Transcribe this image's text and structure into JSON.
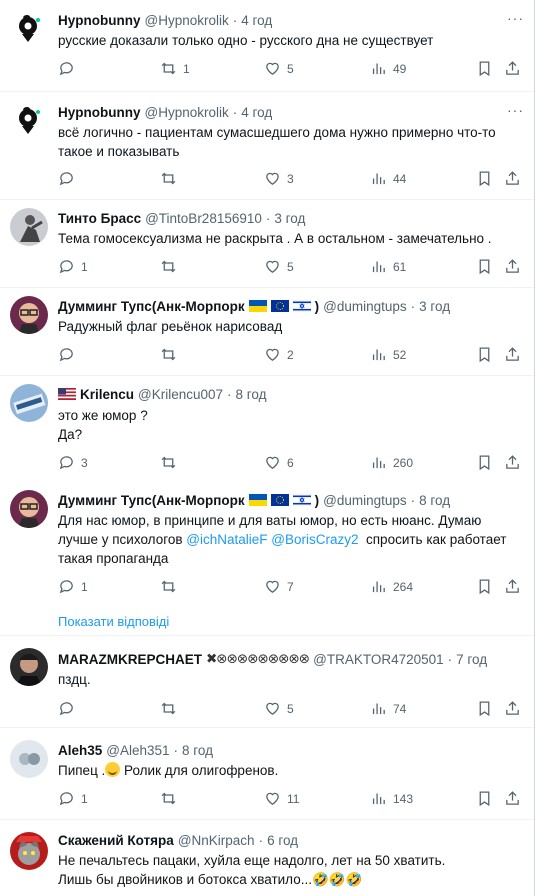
{
  "colors": {
    "accent": "#1d9bf0",
    "muted": "#536471",
    "border": "#eff3f4"
  },
  "tweets": [
    {
      "name": "Hypnobunny",
      "handle": "@Hypnokrolik",
      "time": "4 год",
      "text": "русские доказали только одно - русского дна не существует",
      "replies": "",
      "retweets": "1",
      "likes": "5",
      "views": "49"
    },
    {
      "name": "Hypnobunny",
      "handle": "@Hypnokrolik",
      "time": "4 год",
      "text": "всё логично - пациентам сумасшедшего дома нужно примерно что-то\nтакое и показывать",
      "replies": "",
      "retweets": "",
      "likes": "3",
      "views": "44"
    },
    {
      "name": "Тинто Брасс",
      "handle": "@TintoBr28156910",
      "time": "3 год",
      "text": "Тема гомосексуализма не раскрыта . А в остальном - замечательно .",
      "replies": "1",
      "retweets": "",
      "likes": "5",
      "views": "61"
    },
    {
      "name": "Думминг Тупс(Анк-Морпорк",
      "handle": "@dumingtups",
      "time": "3 год",
      "text": "Радужный флаг рeьёнок нарисовад",
      "replies": "",
      "retweets": "",
      "likes": "2",
      "views": "52"
    },
    {
      "name": "Krilencu",
      "handle": "@Krilencu007",
      "time": "8 год",
      "text": "это же юмор ?\nДа?",
      "replies": "3",
      "retweets": "",
      "likes": "6",
      "views": "260"
    },
    {
      "name": "Думминг Тупс(Анк-Морпорк",
      "handle": "@dumingtups",
      "time": "8 год",
      "text_parts": {
        "a": "Для нас юмор, в принципе и для ваты юмор, но есть нюанс. Думаю\nлучше у психологов ",
        "m1": "@ichNatalieF",
        "m2": "@BorisCrazy2",
        "b": "  спросить как работает\nтакая пропаганда"
      },
      "replies": "1",
      "retweets": "",
      "likes": "7",
      "views": "264"
    },
    {
      "name": "MARAZMKREPCHAET",
      "name_suffix": "✖⊗⊗⊗⊗⊗⊗⊗⊗⊗",
      "handle": "@TRAKTOR4720501",
      "time": "7 год",
      "text": "пздц.",
      "replies": "",
      "retweets": "",
      "likes": "5",
      "views": "74"
    },
    {
      "name": "Aleh35",
      "handle": "@Aleh351",
      "time": "8 год",
      "text_a": "Пипец .",
      "text_b": " Ролик для олигофренов.",
      "replies": "1",
      "retweets": "",
      "likes": "11",
      "views": "143"
    },
    {
      "name": "Скажений Котяра",
      "handle": "@NnKirpach",
      "time": "6 год",
      "text": "Не печальтесь пацаки, хуйла еще надолго, лет на 50 хватить.\nЛишь бы двойников и ботокса хватило...🤣🤣🤣"
    }
  ],
  "show_replies": "Показати відповіді",
  "icons": {
    "reply": "reply-icon",
    "retweet": "retweet-icon",
    "like": "heart-icon",
    "views": "views-icon",
    "bookmark": "bookmark-icon",
    "share": "share-icon",
    "more": "more-icon"
  }
}
